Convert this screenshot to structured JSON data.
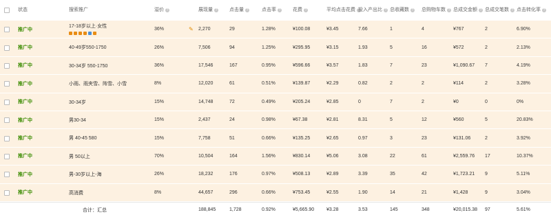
{
  "headers": {
    "status": "状态",
    "keyword": "搜索推广",
    "discount": "溢价",
    "impressions": "展现量",
    "clicks": "点击量",
    "ctr": "点击率",
    "cost": "花费",
    "avg_cpc": "平均点击花费",
    "roi": "投入产出比",
    "favorites": "总收藏数",
    "cart": "总购物车数",
    "sales_amount": "总成交金额",
    "sales_count": "总成交笔数",
    "conversion": "点击转化率"
  },
  "rows": [
    {
      "status": "推广中",
      "keyword": "17-18岁以上·女性",
      "discount": "36%",
      "impressions": "2,270",
      "clicks": "29",
      "ctr": "1.28%",
      "cost": "¥100.08",
      "avg_cpc": "¥3.45",
      "roi": "7.66",
      "favorites": "1",
      "cart": "4",
      "sales_amount": "¥767",
      "sales_count": "2",
      "conversion": "6.90%"
    },
    {
      "status": "推广中",
      "keyword": "40-49岁550-1750",
      "discount": "26%",
      "impressions": "7,506",
      "clicks": "94",
      "ctr": "1.25%",
      "cost": "¥295.95",
      "avg_cpc": "¥3.15",
      "roi": "1.93",
      "favorites": "5",
      "cart": "16",
      "sales_amount": "¥572",
      "sales_count": "2",
      "conversion": "2.13%"
    },
    {
      "status": "推广中",
      "keyword": "30-34岁 550-1750",
      "discount": "36%",
      "impressions": "17,546",
      "clicks": "167",
      "ctr": "0.95%",
      "cost": "¥596.66",
      "avg_cpc": "¥3.57",
      "roi": "1.83",
      "favorites": "7",
      "cart": "23",
      "sales_amount": "¥1,090.67",
      "sales_count": "7",
      "conversion": "4.19%"
    },
    {
      "status": "推广中",
      "keyword": "小雨、雨夹雪、阵雪、小雪",
      "discount": "8%",
      "impressions": "12,020",
      "clicks": "61",
      "ctr": "0.51%",
      "cost": "¥139.87",
      "avg_cpc": "¥2.29",
      "roi": "0.82",
      "favorites": "2",
      "cart": "2",
      "sales_amount": "¥114",
      "sales_count": "2",
      "conversion": "3.28%"
    },
    {
      "status": "推广中",
      "keyword": "30-34岁",
      "discount": "15%",
      "impressions": "14,748",
      "clicks": "72",
      "ctr": "0.49%",
      "cost": "¥205.24",
      "avg_cpc": "¥2.85",
      "roi": "0",
      "favorites": "7",
      "cart": "2",
      "sales_amount": "¥0",
      "sales_count": "0",
      "conversion": "0%"
    },
    {
      "status": "推广中",
      "keyword": "男30-34",
      "discount": "15%",
      "impressions": "2,437",
      "clicks": "24",
      "ctr": "0.98%",
      "cost": "¥67.38",
      "avg_cpc": "¥2.81",
      "roi": "8.31",
      "favorites": "5",
      "cart": "12",
      "sales_amount": "¥560",
      "sales_count": "5",
      "conversion": "20.83%"
    },
    {
      "status": "推广中",
      "keyword": "男 40-45 580",
      "discount": "15%",
      "impressions": "7,758",
      "clicks": "51",
      "ctr": "0.66%",
      "cost": "¥135.25",
      "avg_cpc": "¥2.65",
      "roi": "0.97",
      "favorites": "3",
      "cart": "23",
      "sales_amount": "¥131.06",
      "sales_count": "2",
      "conversion": "3.92%"
    },
    {
      "status": "推广中",
      "keyword": "男 50以上",
      "discount": "70%",
      "impressions": "10,504",
      "clicks": "164",
      "ctr": "1.56%",
      "cost": "¥830.14",
      "avg_cpc": "¥5.06",
      "roi": "3.08",
      "favorites": "22",
      "cart": "61",
      "sales_amount": "¥2,559.76",
      "sales_count": "17",
      "conversion": "10.37%"
    },
    {
      "status": "推广中",
      "keyword": "男-30岁以上-海",
      "discount": "26%",
      "impressions": "18,232",
      "clicks": "176",
      "ctr": "0.97%",
      "cost": "¥508.13",
      "avg_cpc": "¥2.89",
      "roi": "3.39",
      "favorites": "35",
      "cart": "42",
      "sales_amount": "¥1,723.21",
      "sales_count": "9",
      "conversion": "5.11%"
    },
    {
      "status": "推广中",
      "keyword": "高消费",
      "discount": "8%",
      "impressions": "44,657",
      "clicks": "296",
      "ctr": "0.66%",
      "cost": "¥753.45",
      "avg_cpc": "¥2.55",
      "roi": "1.90",
      "favorites": "14",
      "cart": "21",
      "sales_amount": "¥1,428",
      "sales_count": "9",
      "conversion": "3.04%"
    }
  ],
  "total": {
    "label": "合计：汇总",
    "impressions": "188,845",
    "clicks": "1,728",
    "ctr": "0.92%",
    "cost": "¥5,665.90",
    "avg_cpc": "¥3.28",
    "roi": "3.53",
    "favorites": "145",
    "cart": "348",
    "sales_amount": "¥20,015.38",
    "sales_count": "97",
    "conversion": "5.61%"
  },
  "colors": {
    "row_bg": "#fdf1e1",
    "status_green": "#3a8b00",
    "icon_orange": "#e88c14"
  }
}
